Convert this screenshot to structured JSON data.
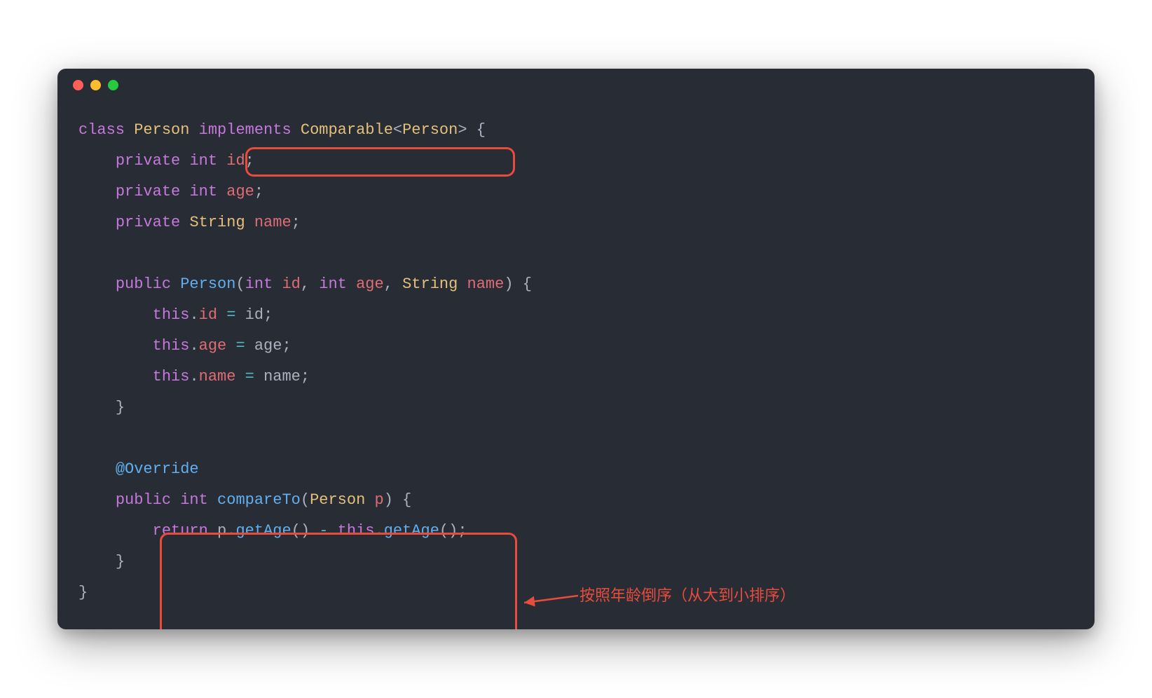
{
  "code": {
    "line1": {
      "kw_class": "class",
      "type_person": "Person",
      "kw_implements": "implements",
      "type_comparable": "Comparable",
      "lt": "<",
      "generic": "Person",
      "gt": ">",
      "brace": " {"
    },
    "line2": {
      "kw_private": "private",
      "kw_int": "int",
      "ident": "id",
      "semi": ";"
    },
    "line3": {
      "kw_private": "private",
      "kw_int": "int",
      "ident": "age",
      "semi": ";"
    },
    "line4": {
      "kw_private": "private",
      "type_string": "String",
      "ident": "name",
      "semi": ";"
    },
    "line6": {
      "kw_public": "public",
      "method": "Person",
      "lp": "(",
      "kw_int1": "int",
      "p1": "id",
      "c1": ", ",
      "kw_int2": "int",
      "p2": "age",
      "c2": ", ",
      "type_string": "String",
      "p3": "name",
      "rp": ")",
      "brace": " {"
    },
    "line7": {
      "this": "this",
      "dot": ".",
      "field": "id",
      "eq": " = ",
      "val": "id",
      "semi": ";"
    },
    "line8": {
      "this": "this",
      "dot": ".",
      "field": "age",
      "eq": " = ",
      "val": "age",
      "semi": ";"
    },
    "line9": {
      "this": "this",
      "dot": ".",
      "field": "name",
      "eq": " = ",
      "val": "name",
      "semi": ";"
    },
    "line10": {
      "brace": "}"
    },
    "line12": {
      "anno": "@Override"
    },
    "line13": {
      "kw_public": "public",
      "kw_int": "int",
      "method": "compareTo",
      "lp": "(",
      "type": "Person",
      "param": "p",
      "rp": ")",
      "brace": " {"
    },
    "line14": {
      "kw_return": "return",
      "p": "p",
      "dot1": ".",
      "m1": "getAge",
      "call1": "()",
      "minus": " - ",
      "this": "this",
      "dot2": ".",
      "m2": "getAge",
      "call2": "()",
      "semi": ";"
    },
    "line15": {
      "brace": "}"
    },
    "line16": {
      "brace": "}"
    }
  },
  "annotation": {
    "text": "按照年龄倒序（从大到小排序）"
  },
  "colors": {
    "background": "#282c34",
    "highlight_border": "#e74c3c",
    "keyword": "#c678dd",
    "type": "#e5c07b",
    "identifier": "#e06c75",
    "method": "#61afef",
    "plain": "#abb2bf",
    "operator": "#56b6c2"
  }
}
